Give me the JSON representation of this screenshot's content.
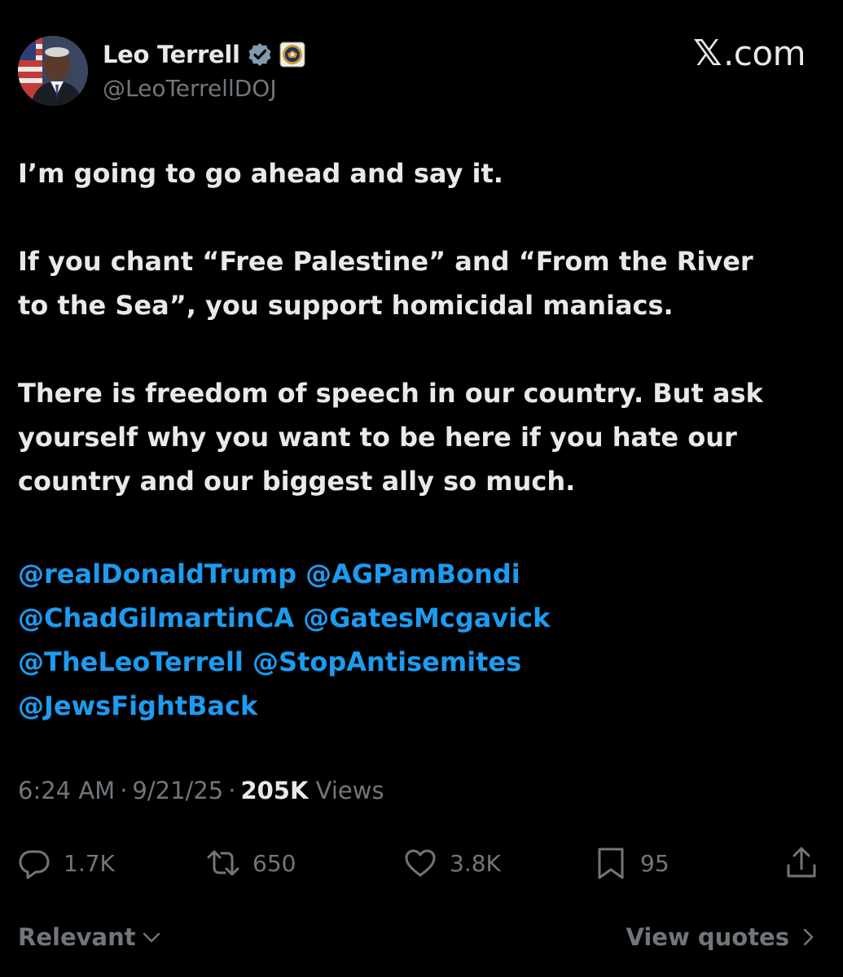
{
  "author": {
    "display_name": "Leo Terrell",
    "handle": "@LeoTerrellDOJ"
  },
  "site_label": "𝕏.com",
  "site": {
    "mark": "𝕏",
    "suffix": ".com"
  },
  "tweet": {
    "paragraphs": [
      "I’m going to go ahead and say it.",
      "If you chant “Free Palestine” and “From the River\nto the Sea”, you support homicidal maniacs.",
      "There is freedom of speech in our country. But ask\nyourself why you want to be here if you hate our\ncountry and our biggest ally so much."
    ],
    "mentions": [
      "@realDonaldTrump",
      "@AGPamBondi",
      "@ChadGilmartinCA",
      "@GatesMcgavick",
      "@TheLeoTerrell",
      "@StopAntisemites",
      "@JewsFightBack"
    ]
  },
  "meta": {
    "time": "6:24 AM",
    "date": "9/21/25",
    "separator": "·",
    "views_count": "205K",
    "views_label": "Views"
  },
  "actions": {
    "replies": "1.7K",
    "reposts": "650",
    "likes": "3.8K",
    "bookmarks": "95"
  },
  "footer": {
    "sort_label": "Relevant",
    "view_quotes_label": "View quotes"
  },
  "icons": {
    "verified": "verified-badge-icon",
    "affiliate": "doj-seal-icon",
    "reply": "reply-icon",
    "repost": "repost-icon",
    "like": "heart-icon",
    "bookmark": "bookmark-icon",
    "share": "share-icon",
    "sort": "chevron-down-icon",
    "quotes": "chevron-right-icon"
  },
  "colors": {
    "background": "#000000",
    "text_primary": "#e7e9ea",
    "text_secondary": "#71767b",
    "link": "#1d9bf0",
    "verified_badge": "#829aab"
  }
}
